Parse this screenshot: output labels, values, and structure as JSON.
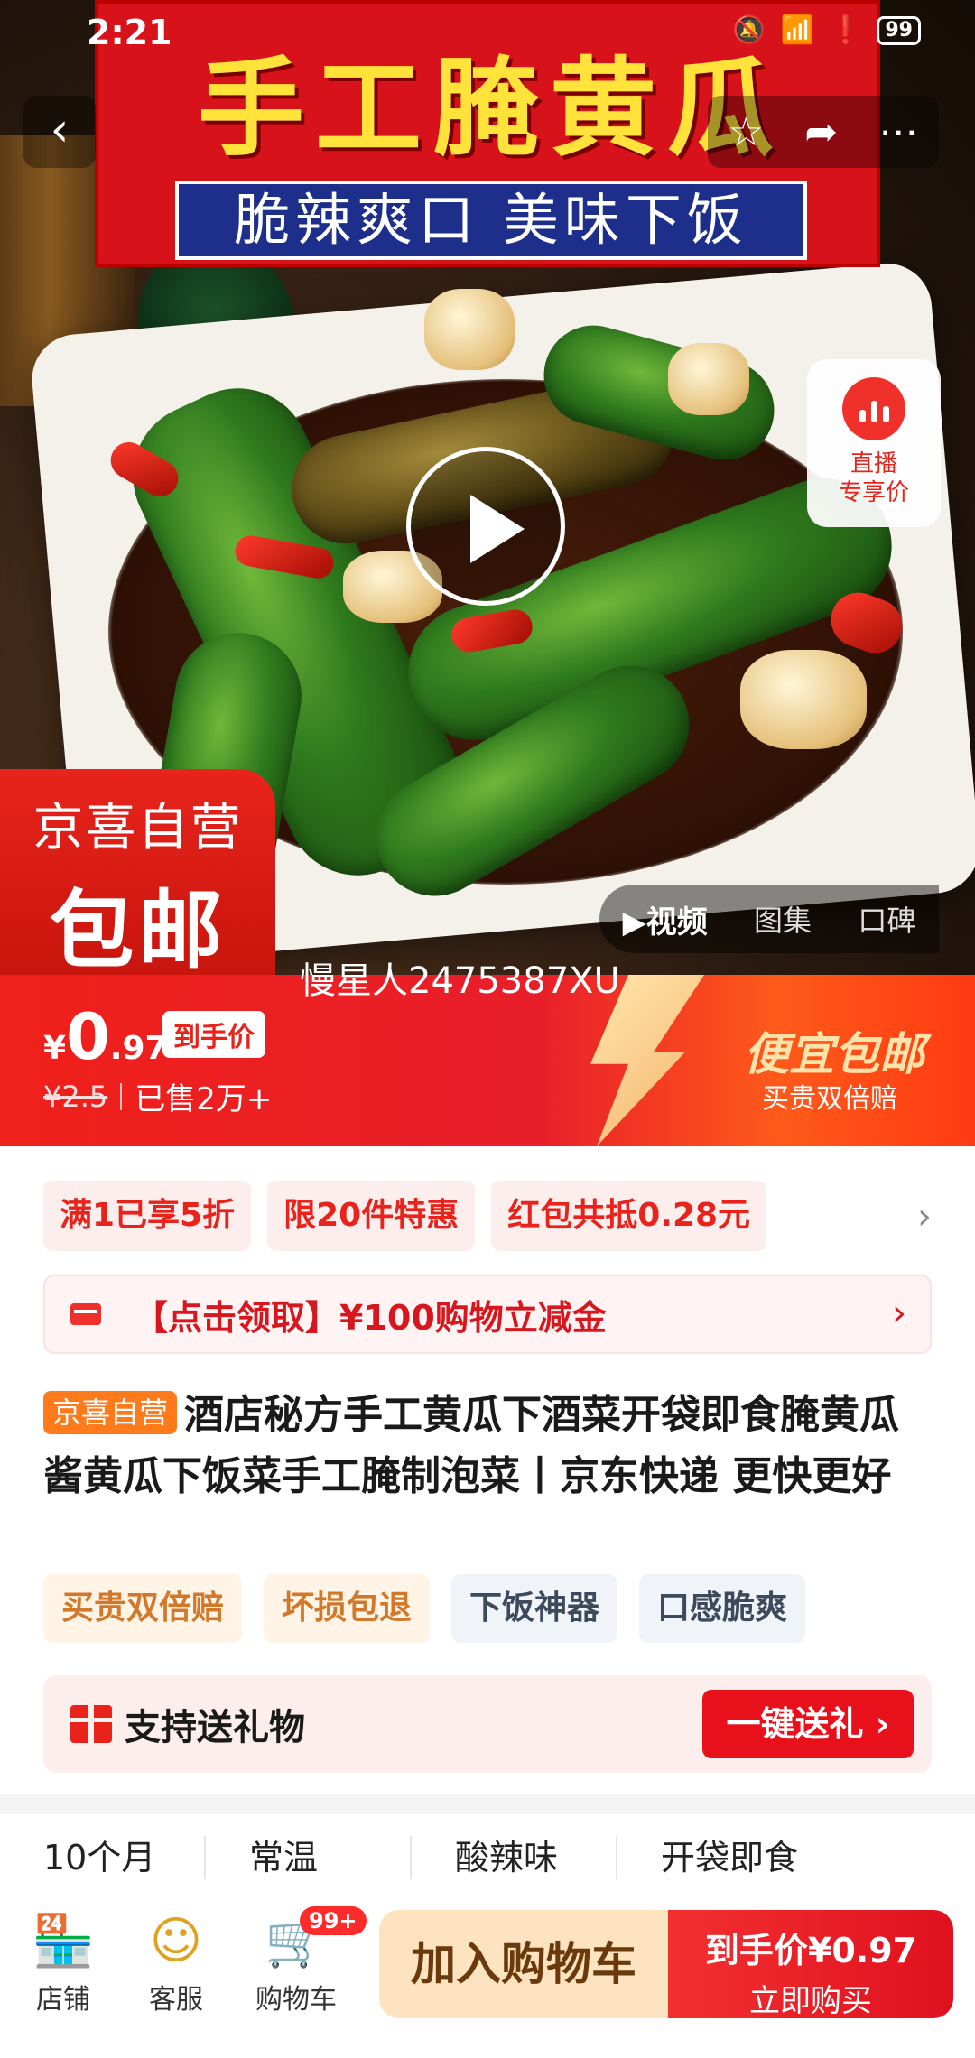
{
  "status_bar": {
    "time": "2:21",
    "battery": "99"
  },
  "hero": {
    "banner_title": "手工腌黄瓜",
    "banner_subtitle": "脆辣爽口 美味下饭",
    "live_card": {
      "line1": "直播",
      "line2": "专享价"
    },
    "promo_badge": {
      "line1": "京喜自营",
      "line2": "包邮"
    },
    "media_tabs": [
      "视频",
      "图集",
      "口碑"
    ],
    "watermark": "慢星人2475387XU"
  },
  "price": {
    "currency": "¥",
    "integer": "0",
    "decimal": ".97",
    "tag": "到手价",
    "original": "¥2.5",
    "sold": "已售2万+",
    "promo_title": "便宜包邮",
    "promo_sub": "买贵双倍赔"
  },
  "coupons": [
    "满1已享5折",
    "限20件特惠",
    "红包共抵0.28元"
  ],
  "voucher": {
    "text": "【点击领取】¥100购物立减金"
  },
  "product": {
    "badge": "京喜自营",
    "title": "酒店秘方手工黄瓜下酒菜开袋即食腌黄瓜酱黄瓜下饭菜手工腌制泡菜丨京东快递 更快更好"
  },
  "tags": [
    "买贵双倍赔",
    "坏损包退",
    "下饭神器",
    "口感脆爽"
  ],
  "gift": {
    "text": "支持送礼物",
    "button": "一键送礼 ›"
  },
  "specs": [
    "10个月",
    "常温",
    "酸辣味",
    "开袋即食"
  ],
  "bottom_bar": {
    "store": "店铺",
    "service": "客服",
    "cart": "购物车",
    "cart_badge": "99+",
    "add_to_cart": "加入购物车",
    "buy_line1": "到手价¥0.97",
    "buy_line2": "立即购买"
  },
  "colors": {
    "accent": "#e8231c",
    "promo_gold": "#ffe3a8",
    "self_badge": "#ff7a1a"
  }
}
